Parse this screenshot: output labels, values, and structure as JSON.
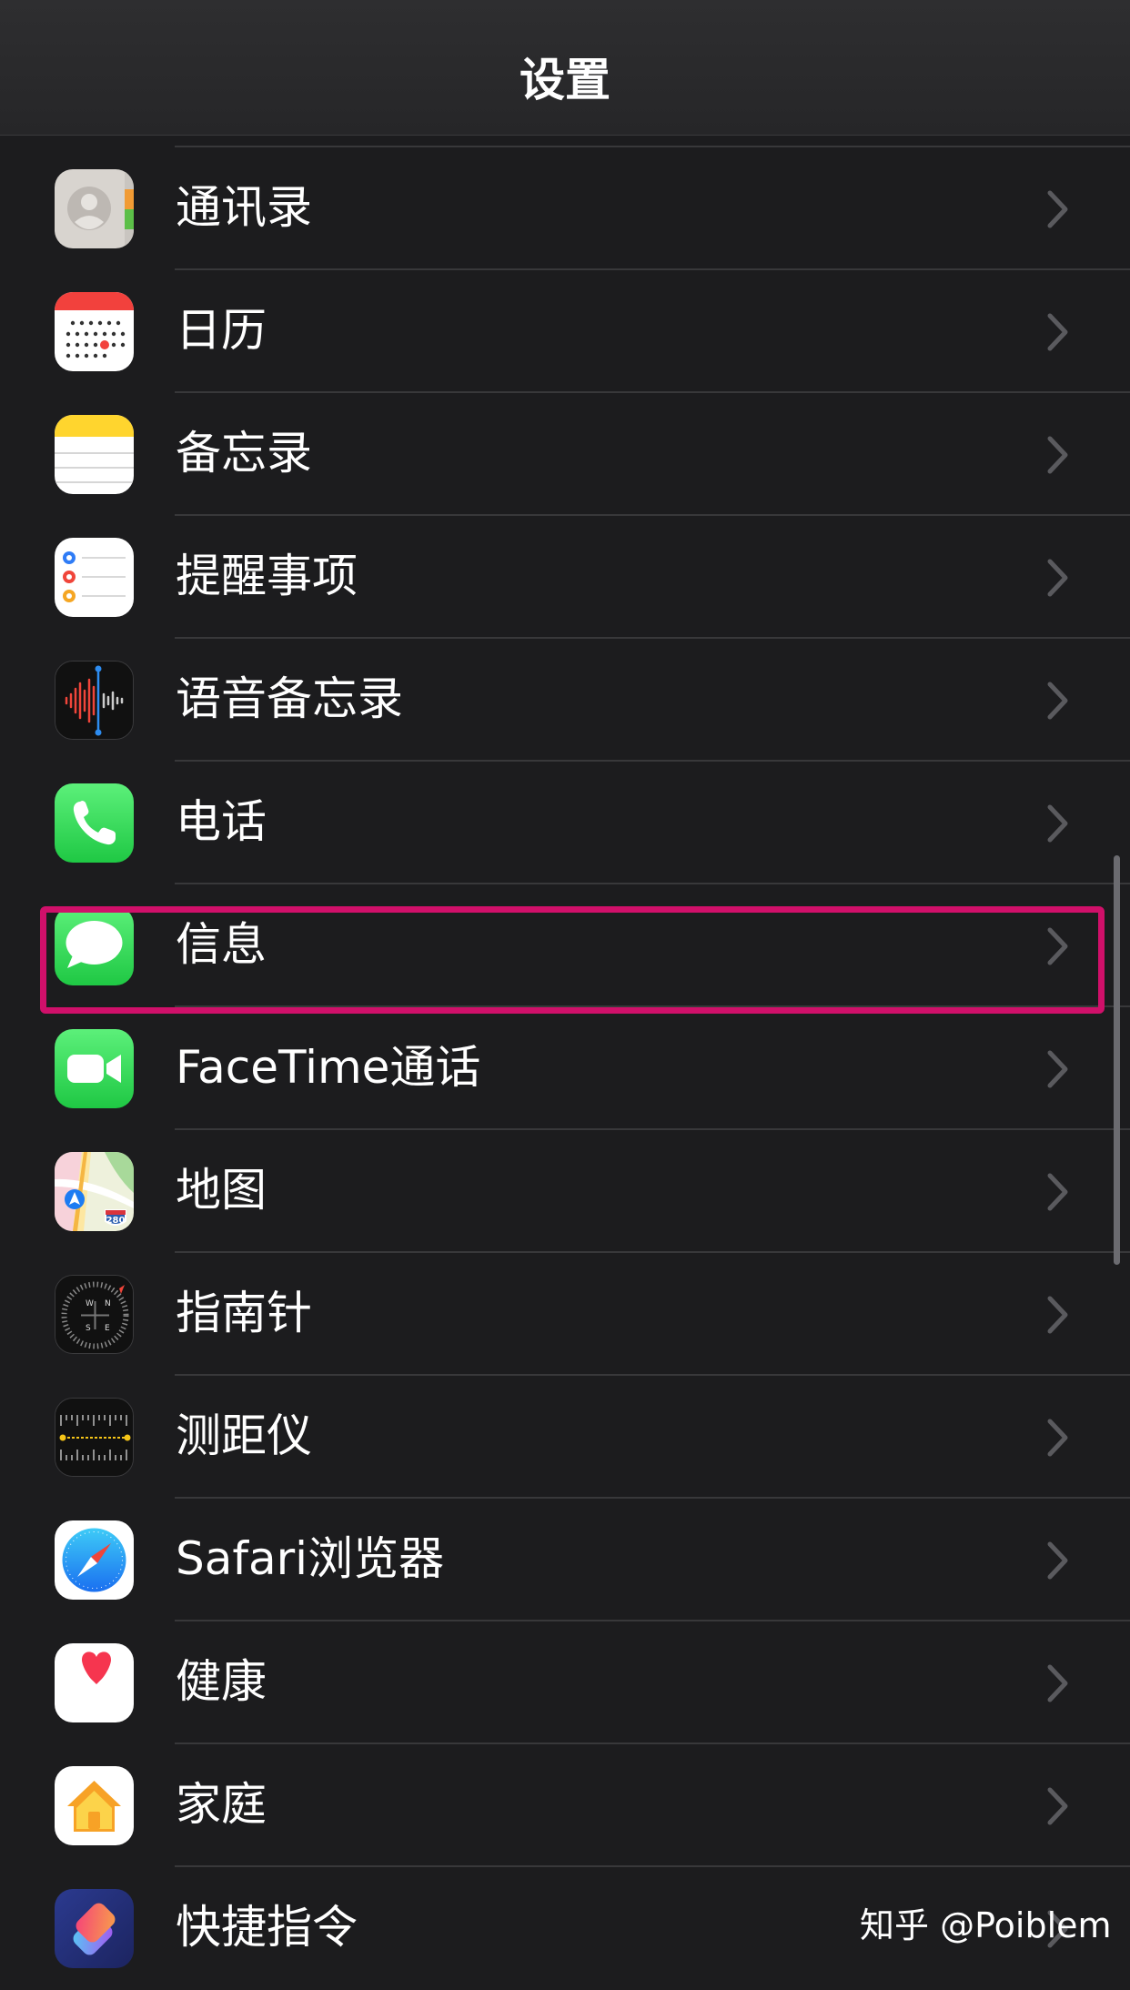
{
  "nav": {
    "title": "设置"
  },
  "settings": [
    {
      "label": "通讯录",
      "icon": "contacts-icon"
    },
    {
      "label": "日历",
      "icon": "calendar-icon"
    },
    {
      "label": "备忘录",
      "icon": "notes-icon"
    },
    {
      "label": "提醒事项",
      "icon": "reminders-icon"
    },
    {
      "label": "语音备忘录",
      "icon": "voice-memos-icon"
    },
    {
      "label": "电话",
      "icon": "phone-icon"
    },
    {
      "label": "信息",
      "icon": "messages-icon"
    },
    {
      "label": "FaceTime通话",
      "icon": "facetime-icon"
    },
    {
      "label": "地图",
      "icon": "maps-icon"
    },
    {
      "label": "指南针",
      "icon": "compass-icon"
    },
    {
      "label": "测距仪",
      "icon": "measure-icon"
    },
    {
      "label": "Safari浏览器",
      "icon": "safari-icon"
    },
    {
      "label": "健康",
      "icon": "health-icon"
    },
    {
      "label": "家庭",
      "icon": "home-icon"
    },
    {
      "label": "快捷指令",
      "icon": "shortcuts-icon"
    }
  ],
  "icons": {
    "maps_highway_label": "280",
    "compass_n": "N",
    "compass_e": "E",
    "compass_s": "S",
    "compass_w": "W"
  },
  "watermark": "知乎 @Poiblem",
  "colors": {
    "background": "#1c1c1e",
    "separator": "#38383a",
    "highlight": "#d0106a",
    "chevron": "#5a5a5e"
  }
}
